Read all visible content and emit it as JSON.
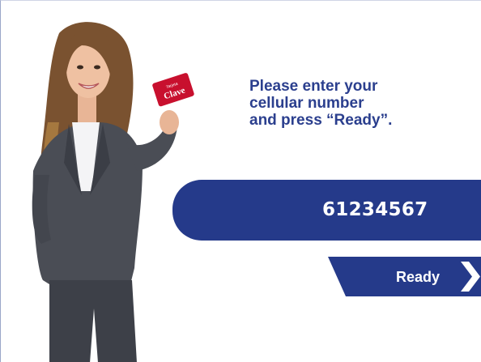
{
  "card": {
    "brand_small": "Tarjeta",
    "brand": "Clave"
  },
  "instruction": {
    "line1": "Please enter your",
    "line2": "cellular number",
    "line3": "and press “Ready”."
  },
  "phone_field": {
    "value": "61234567"
  },
  "ready_button": {
    "label": "Ready"
  },
  "colors": {
    "brand_blue": "#253a8a",
    "text_blue": "#2b3f8e",
    "card_red": "#c8102e"
  }
}
